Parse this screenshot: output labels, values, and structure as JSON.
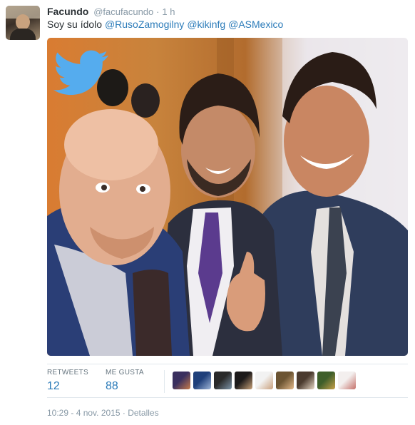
{
  "tweet": {
    "author_name": "Facundo",
    "author_handle": "@facufacundo",
    "separator": "·",
    "time_ago": "1 h",
    "text_plain": "Soy su ídolo ",
    "mentions": [
      "@RusoZamogilny",
      "@kikinfg",
      "@ASMexico"
    ],
    "photo_icon": "twitter-bird-icon"
  },
  "stats": {
    "retweets_label": "RETWEETS",
    "retweets_count": "12",
    "likes_label": "ME GUSTA",
    "likes_count": "88"
  },
  "likers": [
    {
      "colors": [
        "#3a2f5e",
        "#c97b4a"
      ]
    },
    {
      "colors": [
        "#1f3f7a",
        "#9fb6d8"
      ]
    },
    {
      "colors": [
        "#2a2a2a",
        "#7d95a8"
      ]
    },
    {
      "colors": [
        "#1c1a1a",
        "#caa27a"
      ]
    },
    {
      "colors": [
        "#f2f2f2",
        "#caa07c"
      ]
    },
    {
      "colors": [
        "#6c5432",
        "#e3b98a"
      ]
    },
    {
      "colors": [
        "#4b3b2f",
        "#e9d9c6"
      ]
    },
    {
      "colors": [
        "#3e5e2a",
        "#c9a14a"
      ]
    },
    {
      "colors": [
        "#f3efee",
        "#c5716a"
      ]
    }
  ],
  "footer": {
    "timestamp": "10:29 - 4 nov. 2015",
    "separator": "·",
    "details_label": "Detalles"
  },
  "colors": {
    "link": "#2b7bb9",
    "twitter_blue": "#55acee",
    "muted": "#8899a6"
  }
}
